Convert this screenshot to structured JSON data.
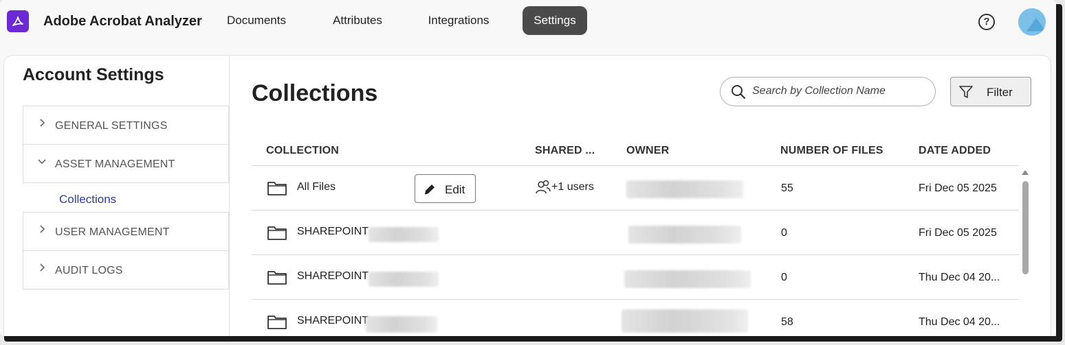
{
  "app": {
    "title": "Adobe Acrobat Analyzer"
  },
  "nav": {
    "tabs": [
      {
        "label": "Documents"
      },
      {
        "label": "Attributes"
      },
      {
        "label": "Integrations"
      },
      {
        "label": "Settings",
        "active": true
      }
    ],
    "help_glyph": "?"
  },
  "sidebar": {
    "title": "Account Settings",
    "sections": [
      {
        "label": "GENERAL SETTINGS",
        "expanded": false
      },
      {
        "label": "ASSET MANAGEMENT",
        "expanded": true,
        "children": [
          {
            "label": "Collections",
            "selected": true
          }
        ]
      },
      {
        "label": "USER MANAGEMENT",
        "expanded": false
      },
      {
        "label": "AUDIT LOGS",
        "expanded": false
      }
    ]
  },
  "main": {
    "title": "Collections",
    "search": {
      "placeholder": "Search by Collection Name",
      "value": ""
    },
    "filter_label": "Filter",
    "edit_label": "Edit",
    "columns": [
      "COLLECTION",
      "SHARED ...",
      "OWNER",
      "NUMBER OF FILES",
      "DATE ADDED"
    ],
    "rows": [
      {
        "collection": "All Files",
        "shared": "+1 users",
        "files": "55",
        "date": "Fri Dec 05 2025"
      },
      {
        "collection": "SHAREPOINT",
        "shared": "",
        "files": "0",
        "date": "Fri Dec 05 2025"
      },
      {
        "collection": "SHAREPOINT",
        "shared": "",
        "files": "0",
        "date": "Thu Dec 04 20..."
      },
      {
        "collection": "SHAREPOINT",
        "shared": "",
        "files": "58",
        "date": "Thu Dec 04 20..."
      }
    ]
  },
  "colors": {
    "brand": "#6d2ad3",
    "active_tab": "#4b4b4b",
    "link": "#2c3fa8"
  }
}
